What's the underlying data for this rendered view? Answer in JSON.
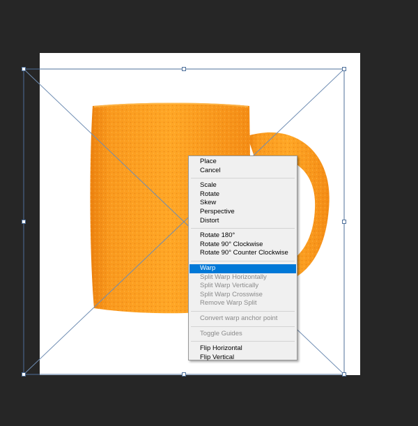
{
  "colors": {
    "workspace_bg": "#262626",
    "canvas_bg": "#ffffff",
    "bounding_box": "#4d6f9a",
    "menu_bg": "#f0f0f0",
    "menu_highlight": "#0078d7",
    "menu_disabled_text": "#8a8a8a",
    "orange": "#f7931e"
  },
  "artwork": {
    "subject": "orange-peel-mug-image"
  },
  "context_menu": {
    "groups": [
      [
        {
          "label": "Place",
          "enabled": true
        },
        {
          "label": "Cancel",
          "enabled": true
        }
      ],
      [
        {
          "label": "Scale",
          "enabled": true
        },
        {
          "label": "Rotate",
          "enabled": true
        },
        {
          "label": "Skew",
          "enabled": true
        },
        {
          "label": "Perspective",
          "enabled": true
        },
        {
          "label": "Distort",
          "enabled": true
        }
      ],
      [
        {
          "label": "Rotate 180°",
          "enabled": true
        },
        {
          "label": "Rotate 90° Clockwise",
          "enabled": true
        },
        {
          "label": "Rotate 90° Counter Clockwise",
          "enabled": true
        }
      ],
      [
        {
          "label": "Warp",
          "enabled": true,
          "selected": true
        },
        {
          "label": "Split Warp Horizontally",
          "enabled": false
        },
        {
          "label": "Split Warp Vertically",
          "enabled": false
        },
        {
          "label": "Split Warp Crosswise",
          "enabled": false
        },
        {
          "label": "Remove Warp Split",
          "enabled": false
        }
      ],
      [
        {
          "label": "Convert warp anchor point",
          "enabled": false
        }
      ],
      [
        {
          "label": "Toggle Guides",
          "enabled": false
        }
      ],
      [
        {
          "label": "Flip Horizontal",
          "enabled": true
        },
        {
          "label": "Flip Vertical",
          "enabled": true
        }
      ]
    ]
  }
}
